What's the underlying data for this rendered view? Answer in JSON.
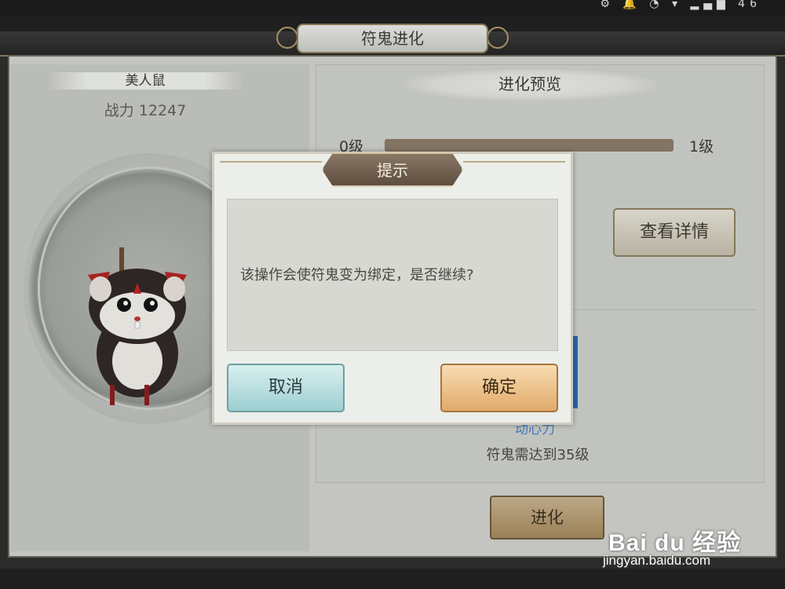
{
  "status_bar": {
    "icons": "⚙ 🔔 ◔ ▾ ▂▄▆ 46"
  },
  "header": {
    "title": "符鬼进化"
  },
  "pet": {
    "name": "美人鼠",
    "power_label": "战力 12247"
  },
  "evolution": {
    "header": "进化预览",
    "level_from": "0级",
    "level_to": "1级",
    "progress": 0.0,
    "details_button": "查看详情",
    "partial_text": "动心力",
    "requirement": "符鬼需达到35级",
    "evolve_button": "进化"
  },
  "dialog": {
    "title": "提示",
    "message": "该操作会使符鬼变为绑定，是否继续?",
    "cancel_label": "取消",
    "confirm_label": "确定"
  },
  "watermark": {
    "logo": "Bai du 经验",
    "url": "jingyan.baidu.com"
  }
}
